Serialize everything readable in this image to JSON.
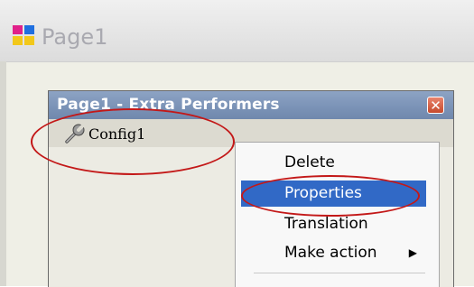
{
  "outer_window": {
    "title": "Page1"
  },
  "extra_performers_window": {
    "title": "Page1 - Extra Performers",
    "close_glyph": "✕",
    "toolbar_item": "Config1"
  },
  "context_menu": {
    "items": [
      {
        "label": "Delete",
        "highlighted": false
      },
      {
        "label": "Properties",
        "highlighted": true
      },
      {
        "label": "Translation",
        "highlighted": false
      },
      {
        "label": "Make action",
        "highlighted": false,
        "submenu": true
      }
    ],
    "submenu_glyph": "▶"
  },
  "annotation_color": "#c31818",
  "highlight_color": "#3169c6"
}
